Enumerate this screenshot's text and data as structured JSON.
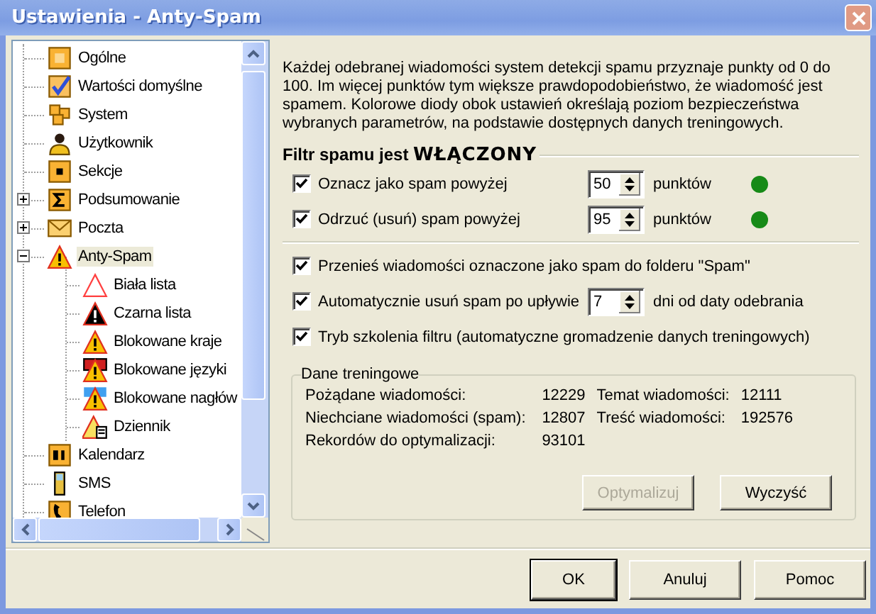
{
  "window": {
    "title": "Ustawienia - Anty-Spam"
  },
  "tree": {
    "items": [
      {
        "label": "Ogólne",
        "selected": false
      },
      {
        "label": "Wartości domyślne",
        "selected": false
      },
      {
        "label": "System",
        "selected": false
      },
      {
        "label": "Użytkownik",
        "selected": false
      },
      {
        "label": "Sekcje",
        "selected": false
      },
      {
        "label": "Podsumowanie",
        "selected": false,
        "expanded": false
      },
      {
        "label": "Poczta",
        "selected": false,
        "expanded": false
      },
      {
        "label": "Anty-Spam",
        "selected": true,
        "expanded": true,
        "children": [
          {
            "label": "Biała lista",
            "selected": false
          },
          {
            "label": "Czarna lista",
            "selected": false
          },
          {
            "label": "Blokowane kraje",
            "selected": false
          },
          {
            "label": "Blokowane języki",
            "selected": false
          },
          {
            "label": "Blokowane nagłów",
            "selected": false
          },
          {
            "label": "Dziennik",
            "selected": false
          }
        ]
      },
      {
        "label": "Kalendarz",
        "selected": false
      },
      {
        "label": "SMS",
        "selected": false
      },
      {
        "label": "Telefon",
        "selected": false
      }
    ]
  },
  "description": "Każdej odebranej wiadomości system detekcji spamu przyznaje punkty od 0 do 100. Im więcej punktów tym większe prawdopodobieństwo, że wiadomość jest spamem. Kolorowe diody obok ustawień określają poziom bezpieczeństwa wybranych parametrów, na podstawie dostępnych danych treningowych.",
  "filter": {
    "heading": "Filtr spamu jest **WŁĄCZONY**",
    "rows": [
      {
        "label": "Oznacz jako spam powyżej",
        "checked": true,
        "value": "50",
        "unit": "punktów",
        "color": "#178a17"
      },
      {
        "label": "Odrzuć (usuń) spam powyżej",
        "checked": true,
        "value": "95",
        "unit": "punktów",
        "color": "#178a17"
      }
    ]
  },
  "options": [
    {
      "kind": "check",
      "label": "Przenieś wiadomości oznaczone jako spam do folderu \"Spam\"",
      "checked": true
    },
    {
      "kind": "spin",
      "label": "Automatycznie usuń spam po upływie",
      "checked": true,
      "value": "7",
      "unit": "dni od daty odebrania"
    },
    {
      "kind": "check",
      "label": "Tryb szkolenia filtru (automatyczne gromadzenie danych treningowych)",
      "checked": true
    }
  ],
  "training": {
    "title": "Dane treningowe",
    "rows": [
      [
        "Pożądane wiadomości:",
        "12229",
        "Temat wiadomości:",
        "12111"
      ],
      [
        "Niechciane wiadomości (spam):",
        "12807",
        "Treść wiadomości:",
        "192576"
      ],
      [
        "Rekordów do optymalizacji:",
        "93101"
      ]
    ],
    "buttons": [
      {
        "label": "Optymalizuj",
        "disabled": true
      },
      {
        "label": "Wyczyść",
        "disabled": false
      }
    ]
  },
  "dialog_buttons": [
    {
      "label": "OK",
      "default": true
    },
    {
      "label": "Anuluj",
      "default": false
    },
    {
      "label": "Pomoc",
      "default": false
    }
  ]
}
